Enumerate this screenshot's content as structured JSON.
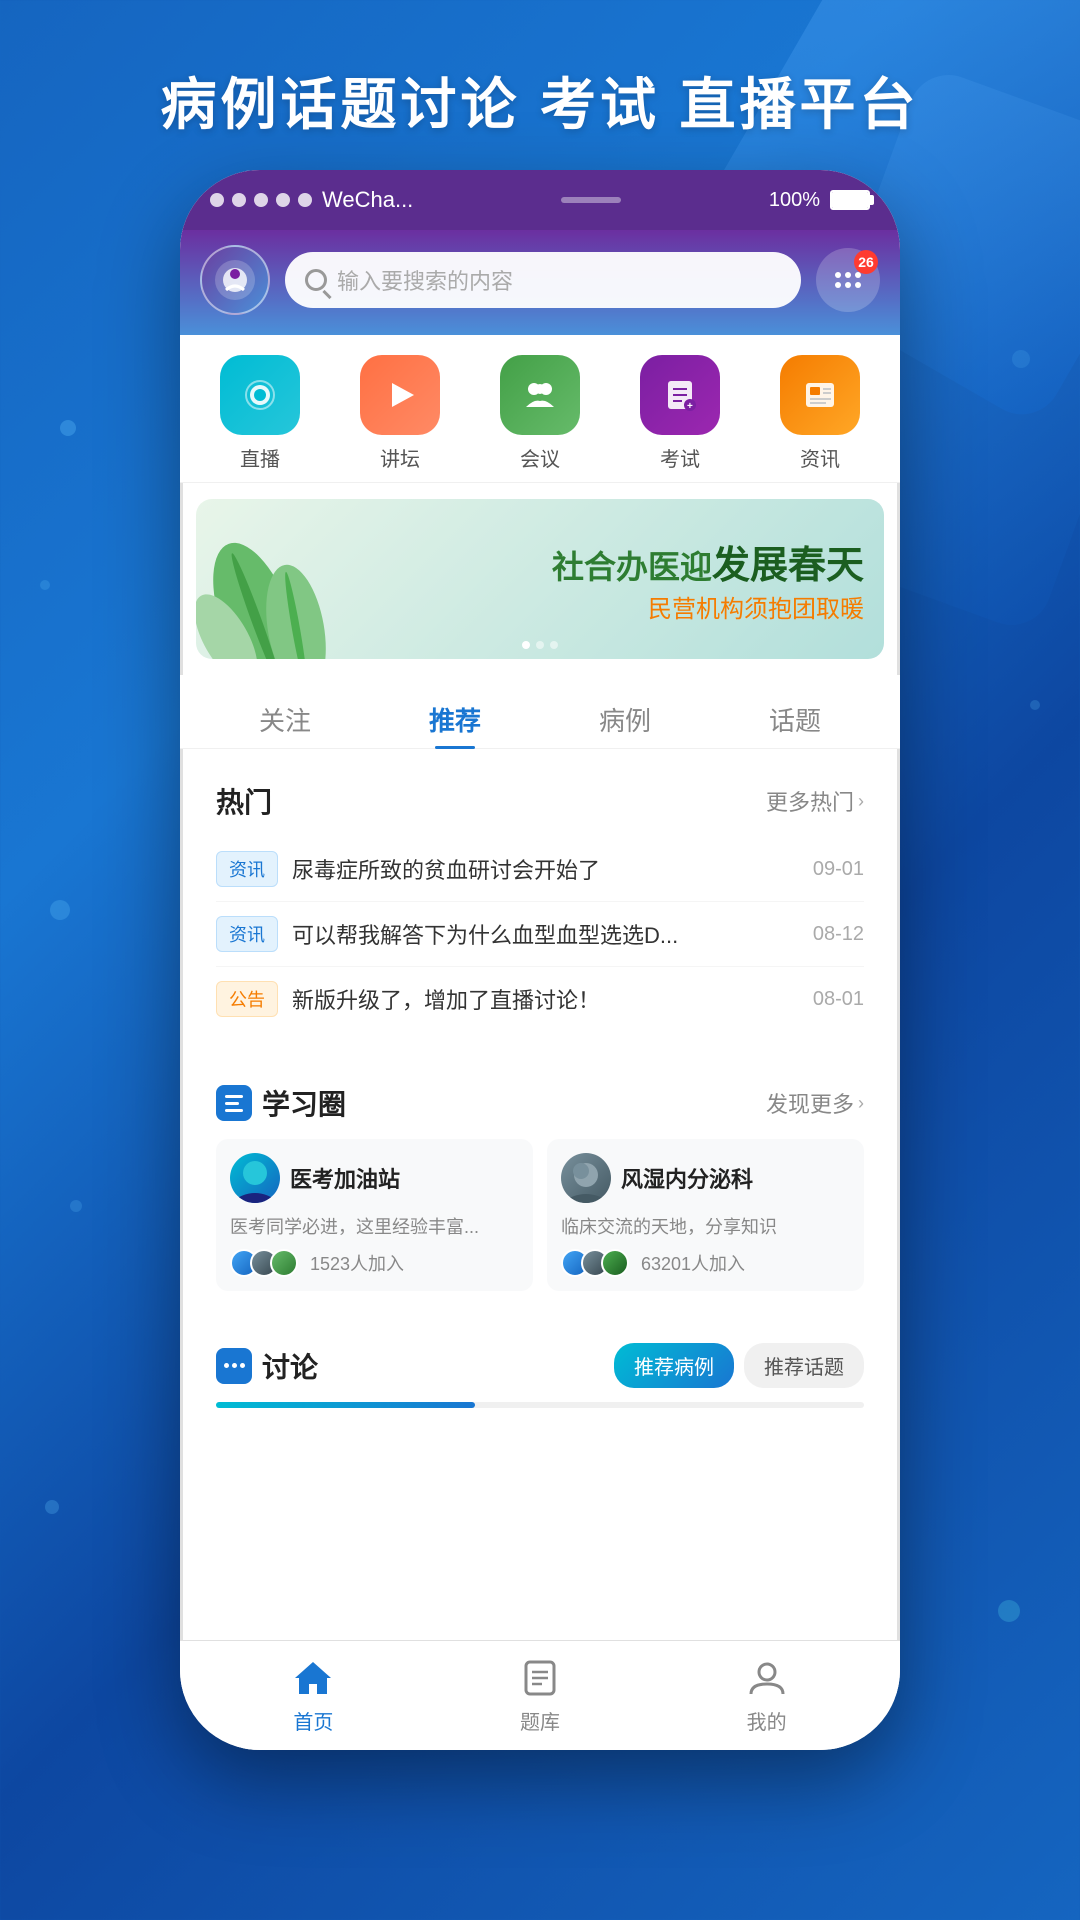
{
  "page": {
    "title": "病例话题讨论 考试 直播平台",
    "background_gradient": "blue"
  },
  "status_bar": {
    "dots_count": 5,
    "app_name": "WeCha...",
    "battery": "100%"
  },
  "header": {
    "logo_alt": "app-logo",
    "search_placeholder": "输入要搜索的内容",
    "notification_count": "26"
  },
  "nav_icons": [
    {
      "id": "live",
      "icon": "📹",
      "label": "直播",
      "icon_class": "icon-live"
    },
    {
      "id": "forum",
      "icon": "▶",
      "label": "讲坛",
      "icon_class": "icon-forum"
    },
    {
      "id": "meeting",
      "icon": "👥",
      "label": "会议",
      "icon_class": "icon-meeting"
    },
    {
      "id": "exam",
      "icon": "📋",
      "label": "考试",
      "icon_class": "icon-exam"
    },
    {
      "id": "news",
      "icon": "📰",
      "label": "资讯",
      "icon_class": "icon-news"
    }
  ],
  "banner": {
    "main_text": "社合办医迎发展春天",
    "sub_text": "民营机构须抱团取暖",
    "dots": 3,
    "active_dot": 1
  },
  "tabs": [
    {
      "id": "follow",
      "label": "关注",
      "active": false
    },
    {
      "id": "recommend",
      "label": "推荐",
      "active": true
    },
    {
      "id": "case",
      "label": "病例",
      "active": false
    },
    {
      "id": "topic",
      "label": "话题",
      "active": false
    }
  ],
  "hot_section": {
    "title": "热门",
    "more_label": "更多热门",
    "items": [
      {
        "tag": "资讯",
        "tag_type": "info",
        "text": "尿毒症所致的贫血研讨会开始了",
        "date": "09-01"
      },
      {
        "tag": "资讯",
        "tag_type": "info",
        "text": "可以帮我解答下为什么血型血型选选D...",
        "date": "08-12"
      },
      {
        "tag": "公告",
        "tag_type": "notice",
        "text": "新版升级了，增加了直播讨论！",
        "date": "08-01"
      }
    ]
  },
  "learning_section": {
    "title": "学习圈",
    "more_label": "发现更多",
    "cards": [
      {
        "id": "card1",
        "title": "医考加油站",
        "desc": "医考同学必进，这里经验丰富...",
        "members": "1523人加入"
      },
      {
        "id": "card2",
        "title": "风湿内分泌科",
        "desc": "临床交流的天地，分享知识",
        "members": "63201人加入"
      }
    ]
  },
  "discussion_section": {
    "title": "讨论",
    "tabs": [
      {
        "id": "recommend-case",
        "label": "推荐病例",
        "active": true
      },
      {
        "id": "recommend-topic",
        "label": "推荐话题",
        "active": false
      }
    ]
  },
  "bottom_nav": [
    {
      "id": "home",
      "label": "首页",
      "active": true
    },
    {
      "id": "questions",
      "label": "题库",
      "active": false
    },
    {
      "id": "profile",
      "label": "我的",
      "active": false
    }
  ]
}
